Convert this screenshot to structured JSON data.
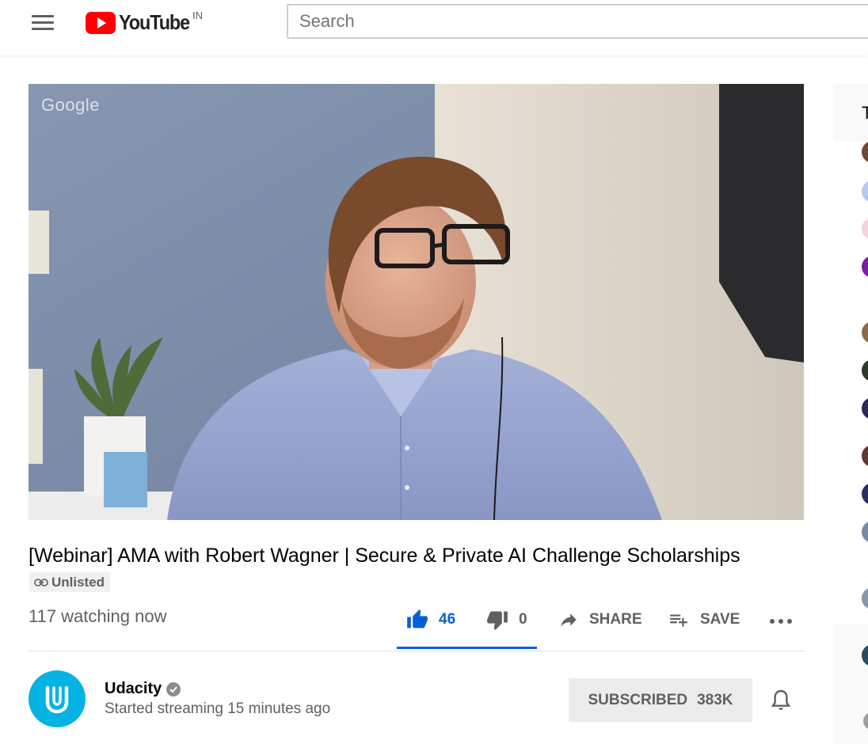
{
  "header": {
    "logo_text": "YouTube",
    "country_code": "IN",
    "search_placeholder": "Search"
  },
  "player": {
    "watermark": "Google"
  },
  "video": {
    "title": "[Webinar] AMA with Robert Wagner | Secure & Private AI Challenge Scholarships",
    "badge": "Unlisted",
    "watching": "117 watching now",
    "likes": "46",
    "dislikes": "0",
    "share_label": "SHARE",
    "save_label": "SAVE"
  },
  "channel": {
    "name": "Udacity",
    "meta": "Started streaming 15 minutes ago",
    "subscribe_label": "SUBSCRIBED",
    "subscriber_count": "383K"
  },
  "sidebar": {
    "header_initial": "T"
  },
  "colors": {
    "accent": "#065fd4",
    "youtube_red": "#ff0000",
    "udacity_blue": "#02b3e4"
  },
  "icons": [
    "menu-icon",
    "youtube-logo-icon",
    "link-icon",
    "thumb-up-icon",
    "thumb-down-icon",
    "share-icon",
    "playlist-add-icon",
    "more-icon",
    "verified-icon",
    "bell-icon"
  ]
}
